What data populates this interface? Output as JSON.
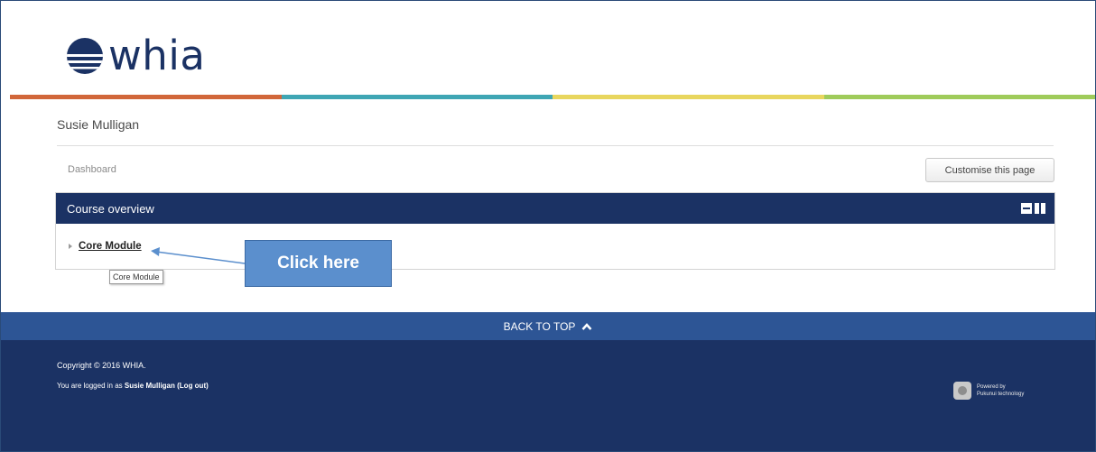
{
  "brand": {
    "logo_text": "whia",
    "navy": "#1b3264",
    "accent_blue": "#2d5595"
  },
  "stripe_colors": [
    "#d1673a",
    "#3fa6b4",
    "#e8d65e",
    "#9fcb5a"
  ],
  "header": {
    "user_name": "Susie Mulligan"
  },
  "nav": {
    "breadcrumb": "Dashboard",
    "customise_label": "Customise this page"
  },
  "block": {
    "title": "Course overview",
    "courses": [
      {
        "name": "Core Module"
      }
    ],
    "tooltip": "Core Module"
  },
  "callout": {
    "text": "Click here",
    "color": "#5b8fcd"
  },
  "back_to_top": {
    "label": "BACK TO TOP"
  },
  "footer": {
    "copyright": "Copyright © 2016 WHIA.",
    "logged_prefix": "You are logged in as ",
    "logged_user": "Susie Mulligan",
    "logout_label": "(Log out)",
    "powered_line1": "Powered by",
    "powered_line2": "Pukunui technology"
  }
}
